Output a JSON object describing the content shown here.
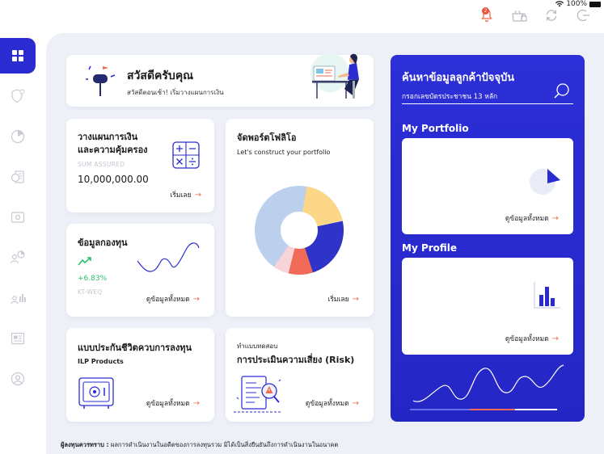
{
  "status_bar": {
    "battery": "100%"
  },
  "greeting": {
    "title": "สวัสดีครับคุณ",
    "subtitle": "สวัสดีตอนเช้า! เริ่มวางแผนการเงิน"
  },
  "notification_badge": "2",
  "cards": {
    "plan": {
      "title_line1": "วางแผนการเงิน",
      "title_line2": "และความคุ้มครอง",
      "sum_label": "SUM ASSURED",
      "amount": "10,000,000.00",
      "link": "เริ่มเลย"
    },
    "fund": {
      "title": "ข้อมูลกองทุน",
      "change": "+6.83%",
      "fund_code": "KT-WEQ",
      "link": "ดูข้อมูลทั้งหมด"
    },
    "portfolio": {
      "title": "จัดพอร์ตโฟลิโอ",
      "subtitle": "Let's construct your portfolio",
      "link": "เริ่มเลย"
    },
    "ilp": {
      "title": "แบบประกันชีวิตควบการลงทุน",
      "subtitle": "ILP Products",
      "link": "ดูข้อมูลทั้งหมด"
    },
    "risk": {
      "caption": "ทำแบบทดสอบ",
      "title": "การประเมินความเสี่ยง (Risk)",
      "link": "ดูข้อมูลทั้งหมด"
    }
  },
  "search_panel": {
    "title": "ค้นหาข้อมูลลูกค้าปัจจุบัน",
    "placeholder": "กรอกเลขบัตรประชาชน 13 หลัก",
    "portfolio_label": "My Portfolio",
    "portfolio_link": "ดูข้อมูลทั้งหมด",
    "profile_label": "My Profile",
    "profile_link": "ดูข้อมูลทั้งหมด"
  },
  "disclaimer": {
    "label": "ผู้ลงทุนควรทราบ :",
    "text": "ผลการดำเนินงานในอดีตของการลงทุนรวม มิได้เป็นสิ่งยืนยันถึงการดำเนินงานในอนาคต"
  },
  "colors": {
    "accent": "#2a2cd1",
    "link_arrow": "#f06a4b",
    "positive": "#2bbf6a"
  }
}
